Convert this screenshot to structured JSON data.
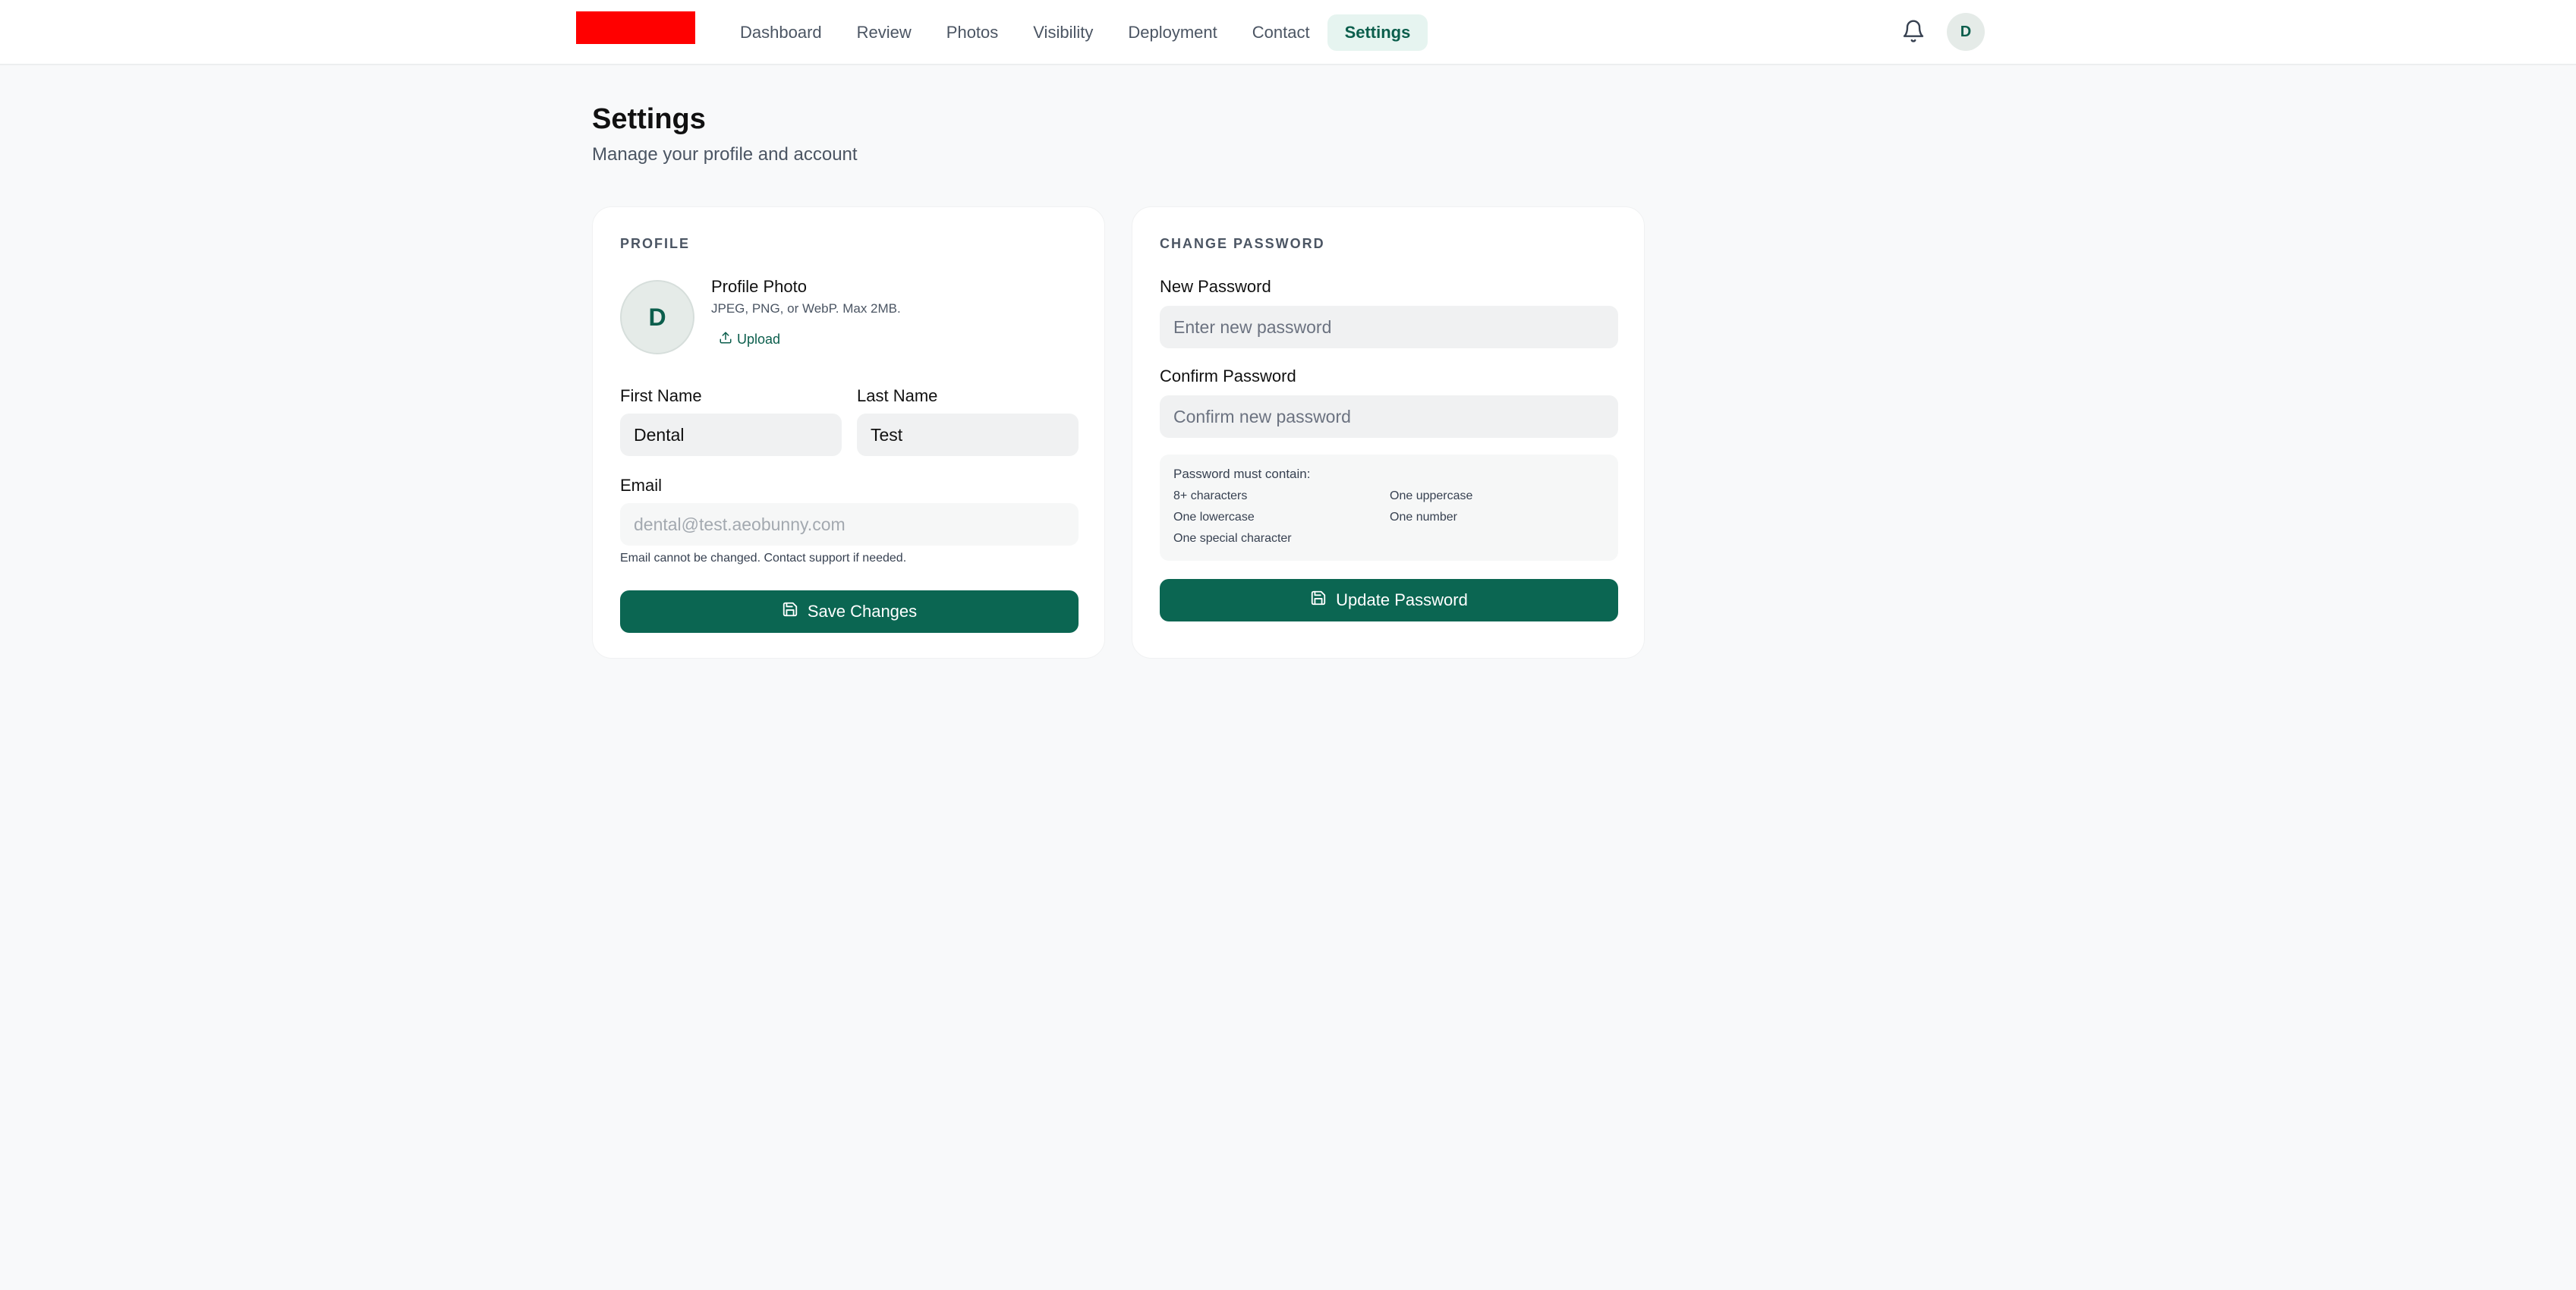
{
  "nav": {
    "logo_color": "#ff0000",
    "items": [
      {
        "label": "Dashboard"
      },
      {
        "label": "Review"
      },
      {
        "label": "Photos"
      },
      {
        "label": "Visibility"
      },
      {
        "label": "Deployment"
      },
      {
        "label": "Contact"
      },
      {
        "label": "Settings",
        "active": true
      }
    ],
    "notification_icon": "bell-icon",
    "avatar_initial": "D"
  },
  "page": {
    "title": "Settings",
    "subtitle": "Manage your profile and account"
  },
  "profile": {
    "section_title": "PROFILE",
    "avatar_initial": "D",
    "photo_title": "Profile Photo",
    "photo_hint": "JPEG, PNG, or WebP. Max 2MB.",
    "upload_label": "Upload",
    "first_name_label": "First Name",
    "first_name_value": "Dental",
    "last_name_label": "Last Name",
    "last_name_value": "Test",
    "email_label": "Email",
    "email_value": "dental@test.aeobunny.com",
    "email_note": "Email cannot be changed. Contact support if needed.",
    "save_label": "Save Changes"
  },
  "password": {
    "section_title": "CHANGE PASSWORD",
    "new_label": "New Password",
    "new_placeholder": "Enter new password",
    "confirm_label": "Confirm Password",
    "confirm_placeholder": "Confirm new password",
    "requirements_title": "Password must contain:",
    "requirements": [
      "8+ characters",
      "One uppercase",
      "One lowercase",
      "One number",
      "One special character"
    ],
    "update_label": "Update Password"
  },
  "colors": {
    "brand_green": "#0b6652",
    "active_tab_bg": "#e6f4f0",
    "page_bg": "#f8f9fa"
  }
}
